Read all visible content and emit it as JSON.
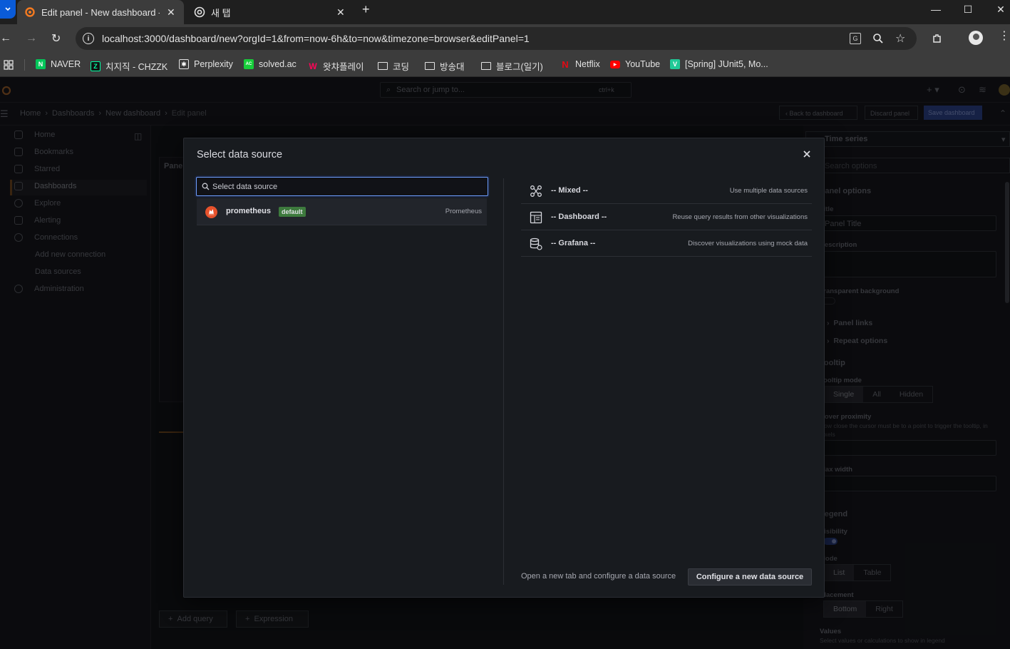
{
  "browser": {
    "tabs": [
      {
        "title": "Edit panel - New dashboard -",
        "active": true
      },
      {
        "title": "새 탭",
        "active": false
      }
    ],
    "new_tab_symbol": "+",
    "url": "localhost:3000/dashboard/new?orgId=1&from=now-6h&to=now&timezone=browser&editPanel=1",
    "bookmarks": [
      {
        "label": "NAVER",
        "icon": "naver-icon",
        "color": "#03c75a"
      },
      {
        "label": "치지직 - CHZZK",
        "icon": "chzzk-icon",
        "color": "#00ffa3"
      },
      {
        "label": "Perplexity",
        "icon": "perplexity-icon",
        "color": "#ffffff"
      },
      {
        "label": "solved.ac",
        "icon": "solvedac-icon",
        "color": "#17ce3a"
      },
      {
        "label": "왓챠플레이",
        "icon": "watcha-icon",
        "color": "#ff0558"
      },
      {
        "label": "코딩",
        "icon": "folder-icon",
        "color": ""
      },
      {
        "label": "방송대",
        "icon": "folder-icon",
        "color": ""
      },
      {
        "label": "블로그(일기)",
        "icon": "folder-icon",
        "color": ""
      },
      {
        "label": "Netflix",
        "icon": "netflix-icon",
        "color": "#e50914"
      },
      {
        "label": "YouTube",
        "icon": "youtube-icon",
        "color": "#ff0000"
      },
      {
        "label": "[Spring] JUnit5, Mo...",
        "icon": "velog-icon",
        "color": "#20c997"
      }
    ]
  },
  "grafana": {
    "search_placeholder": "Search or jump to...",
    "search_shortcut": "ctrl+k",
    "breadcrumb": [
      "Home",
      "Dashboards",
      "New dashboard",
      "Edit panel"
    ],
    "header_buttons": {
      "back": "Back to dashboard",
      "discard": "Discard panel",
      "save": "Save dashboard"
    },
    "sidebar": [
      {
        "label": "Home"
      },
      {
        "label": "Bookmarks"
      },
      {
        "label": "Starred"
      },
      {
        "label": "Dashboards"
      },
      {
        "label": "Explore"
      },
      {
        "label": "Alerting"
      },
      {
        "label": "Connections"
      },
      {
        "label": "Add new connection"
      },
      {
        "label": "Data sources"
      },
      {
        "label": "Administration"
      }
    ],
    "panel_label": "Panel",
    "query_buttons": {
      "add_query": "Add query",
      "expression": "Expression"
    },
    "options": {
      "viz": "Time series",
      "search": "Search options",
      "panel_options": "Panel options",
      "title_label": "Title",
      "title_value": "Panel Title",
      "description_label": "Description",
      "transparent_label": "Transparent background",
      "panel_links": "Panel links",
      "repeat_options": "Repeat options",
      "tooltip": "Tooltip",
      "tooltip_mode": "Tooltip mode",
      "tooltip_modes": [
        "Single",
        "All",
        "Hidden"
      ],
      "hover_label": "Hover proximity",
      "hover_desc": "How close the cursor must be to a point to trigger the tooltip, in pixels",
      "max_width": "Max width",
      "legend": "Legend",
      "visibility": "Visibility",
      "mode": "Mode",
      "modes": [
        "List",
        "Table"
      ],
      "placement": "Placement",
      "placements": [
        "Bottom",
        "Right"
      ],
      "values": "Values",
      "values_desc": "Select values or calculations to show in legend"
    }
  },
  "modal": {
    "title": "Select data source",
    "search_placeholder": "Select data source",
    "datasource": {
      "name": "prometheus",
      "badge": "default",
      "type": "Prometheus"
    },
    "builtins": [
      {
        "name": "-- Mixed --",
        "desc": "Use multiple data sources",
        "icon": "mixed-icon"
      },
      {
        "name": "-- Dashboard --",
        "desc": "Reuse query results from other visualizations",
        "icon": "dashboard-icon"
      },
      {
        "name": "-- Grafana --",
        "desc": "Discover visualizations using mock data",
        "icon": "database-icon"
      }
    ],
    "footer_text": "Open a new tab and configure a data source",
    "configure_button": "Configure a new data source"
  },
  "colors": {
    "accent": "#6e9fff",
    "badge": "#3d7a3d",
    "prometheus": "#e6522c"
  }
}
